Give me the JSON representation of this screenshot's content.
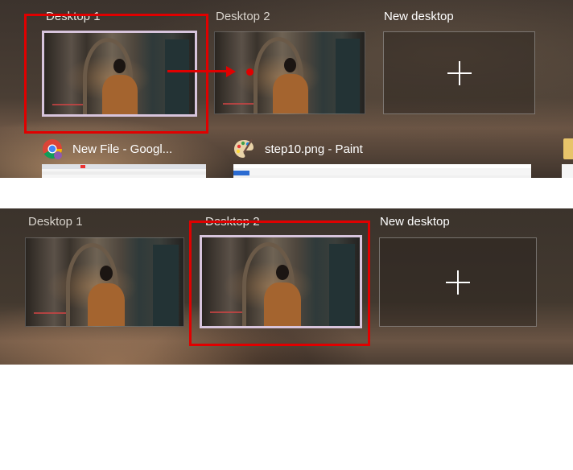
{
  "top": {
    "desktops": [
      {
        "label": "Desktop 1",
        "selected": true
      },
      {
        "label": "Desktop 2",
        "selected": false
      }
    ],
    "new_desktop_label": "New desktop",
    "windows": [
      {
        "title": "New File - Googl...",
        "icon": "chrome-icon"
      },
      {
        "title": "step10.png - Paint",
        "icon": "paint-icon"
      }
    ]
  },
  "bottom": {
    "desktops": [
      {
        "label": "Desktop 1",
        "selected": false
      },
      {
        "label": "Desktop 2",
        "selected": true
      }
    ],
    "new_desktop_label": "New desktop"
  },
  "annotation": {
    "color": "#e00000",
    "selected_border": "#d7c4dc"
  }
}
